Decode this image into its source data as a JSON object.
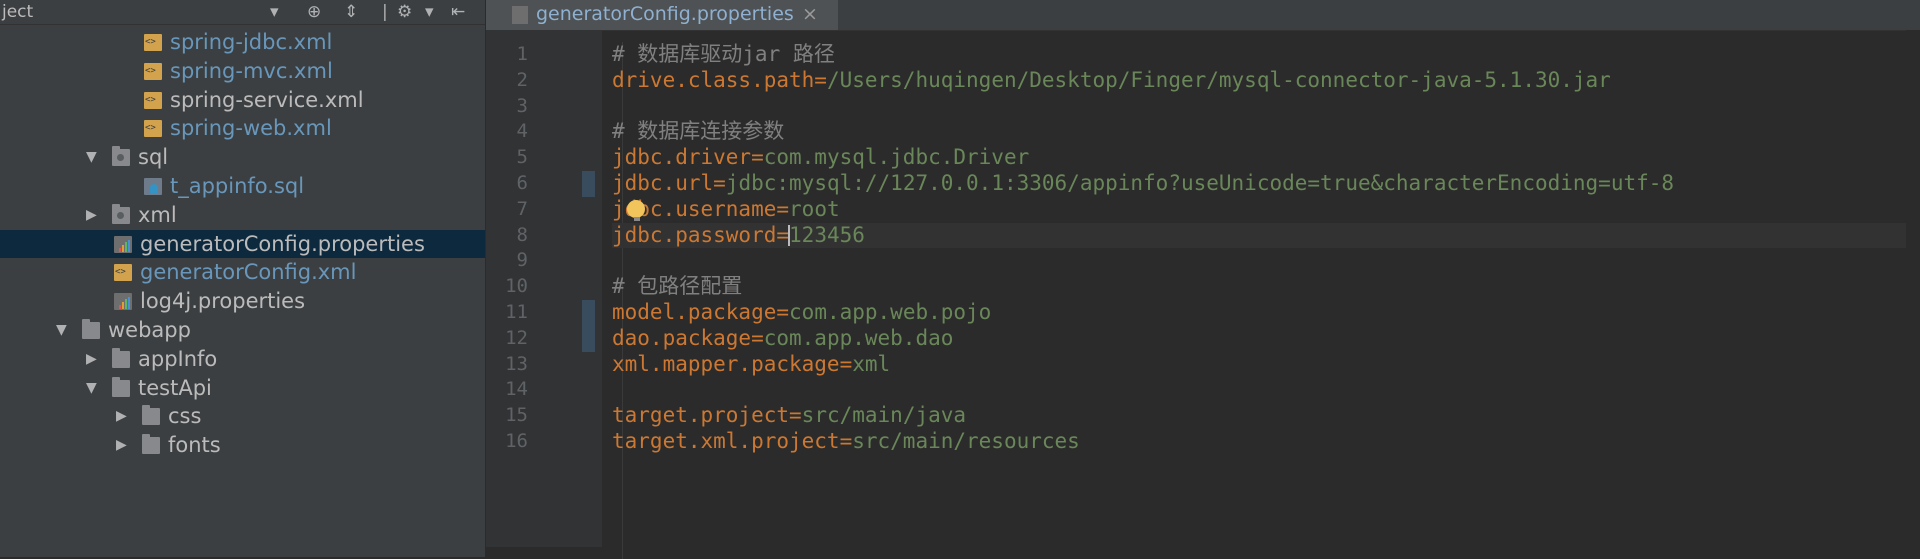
{
  "sidebar": {
    "title": "ject",
    "tree": [
      {
        "label": "spring-jdbc.xml",
        "type": "xml",
        "depth": 4,
        "color": "blue"
      },
      {
        "label": "spring-mvc.xml",
        "type": "xml",
        "depth": 4,
        "color": "blue"
      },
      {
        "label": "spring-service.xml",
        "type": "xml",
        "depth": 4,
        "color": "plain"
      },
      {
        "label": "spring-web.xml",
        "type": "xml",
        "depth": 4,
        "color": "blue"
      },
      {
        "label": "sql",
        "type": "folder-res",
        "depth": 2,
        "arrow": "▼",
        "color": "plain"
      },
      {
        "label": "t_appinfo.sql",
        "type": "sql",
        "depth": 4,
        "color": "blue"
      },
      {
        "label": "xml",
        "type": "folder-res",
        "depth": 2,
        "arrow": "▶",
        "color": "plain"
      },
      {
        "label": "generatorConfig.properties",
        "type": "prop",
        "depth": 3,
        "color": "plain",
        "selected": true
      },
      {
        "label": "generatorConfig.xml",
        "type": "xml",
        "depth": 3,
        "color": "blue"
      },
      {
        "label": "log4j.properties",
        "type": "prop",
        "depth": 3,
        "color": "plain"
      },
      {
        "label": "webapp",
        "type": "folder",
        "depth": 1,
        "arrow": "▼",
        "color": "plain"
      },
      {
        "label": "appInfo",
        "type": "folder",
        "depth": 2,
        "arrow": "▶",
        "color": "plain"
      },
      {
        "label": "testApi",
        "type": "folder",
        "depth": 2,
        "arrow": "▼",
        "color": "plain"
      },
      {
        "label": "css",
        "type": "folder",
        "depth": 3,
        "arrow": "▶",
        "color": "plain"
      },
      {
        "label": "fonts",
        "type": "folder",
        "depth": 3,
        "arrow": "▶",
        "color": "plain"
      }
    ]
  },
  "editor": {
    "tab_label": "generatorConfig.properties",
    "tab_close": "×",
    "lines": [
      {
        "n": "1",
        "comment": "# 数据库驱动jar 路径"
      },
      {
        "n": "2",
        "key": "drive.class.path",
        "eq": "=",
        "val": "/Users/huqingen/Desktop/Finger/mysql-connector-java-5.1.30.jar"
      },
      {
        "n": "3"
      },
      {
        "n": "4",
        "comment": "# 数据库连接参数"
      },
      {
        "n": "5",
        "key": "jdbc.driver",
        "eq": "=",
        "val": "com.mysql.jdbc.Driver"
      },
      {
        "n": "6",
        "key": "jdbc.url",
        "eq": "=",
        "val": "jdbc:mysql://127.0.0.1:3306/appinfo?useUnicode=true&characterEncoding=utf-8",
        "changed": true
      },
      {
        "n": "7",
        "key": "jdbc.username",
        "eq": "=",
        "val": "root"
      },
      {
        "n": "8",
        "key": "jdbc.password",
        "eq": "=",
        "val": "123456",
        "current": true
      },
      {
        "n": "9"
      },
      {
        "n": "10",
        "comment": "# 包路径配置"
      },
      {
        "n": "11",
        "key": "model.package",
        "eq": "=",
        "val": "com.app.web.pojo",
        "changed": true
      },
      {
        "n": "12",
        "key": "dao.package",
        "eq": "=",
        "val": "com.app.web.dao",
        "changed": true
      },
      {
        "n": "13",
        "key": "xml.mapper.package",
        "eq": "=",
        "val": "xml"
      },
      {
        "n": "14"
      },
      {
        "n": "15",
        "key": "target.project",
        "eq": "=",
        "val": "src/main/java"
      },
      {
        "n": "16",
        "key": "target.xml.project",
        "eq": "=",
        "val": "src/main/resources"
      }
    ]
  },
  "colors": {
    "bg": "#2b2b2b",
    "sidebar_bg": "#3c3f41",
    "selection": "#0d293e",
    "comment": "#808080",
    "key": "#cc7832",
    "value": "#6a8759",
    "blue_file": "#6897bb"
  }
}
